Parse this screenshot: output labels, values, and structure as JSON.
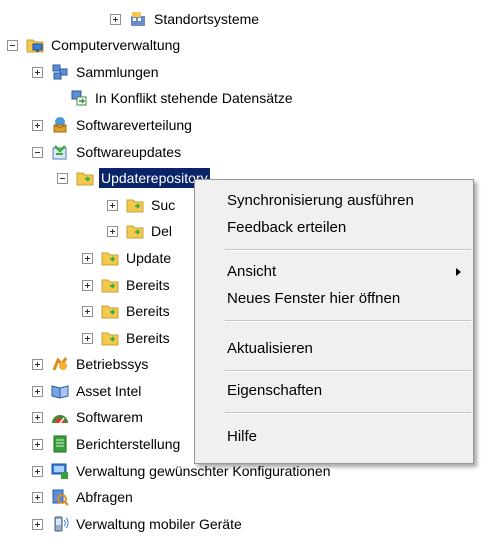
{
  "tree": {
    "items": [
      {
        "label": "Standortsysteme"
      },
      {
        "label": "Computerverwaltung"
      },
      {
        "label": "Sammlungen"
      },
      {
        "label": "In Konflikt stehende Datensätze"
      },
      {
        "label": "Softwareverteilung"
      },
      {
        "label": "Softwareupdates"
      },
      {
        "label": "Updaterepository"
      },
      {
        "label": "Suc"
      },
      {
        "label": "Del"
      },
      {
        "label": "Update"
      },
      {
        "label": "Bereits"
      },
      {
        "label": "Bereits"
      },
      {
        "label": "Bereits"
      },
      {
        "label": "Betriebssys"
      },
      {
        "label": "Asset Intel"
      },
      {
        "label": "Softwarem"
      },
      {
        "label": "Berichterstellung"
      },
      {
        "label": "Verwaltung gewünschter Konfigurationen"
      },
      {
        "label": "Abfragen"
      },
      {
        "label": "Verwaltung mobiler Geräte"
      }
    ]
  },
  "context_menu": {
    "items": [
      {
        "label": "Synchronisierung ausführen"
      },
      {
        "label": "Feedback erteilen"
      },
      {
        "label": "Ansicht"
      },
      {
        "label": "Neues Fenster hier öffnen"
      },
      {
        "label": "Aktualisieren"
      },
      {
        "label": "Eigenschaften"
      },
      {
        "label": "Hilfe"
      }
    ]
  },
  "colors": {
    "selection": "#0a246a",
    "folder": "#f2c94c",
    "folder_arrow": "#3cae3c",
    "menu_bg": "#f0f0f0"
  }
}
